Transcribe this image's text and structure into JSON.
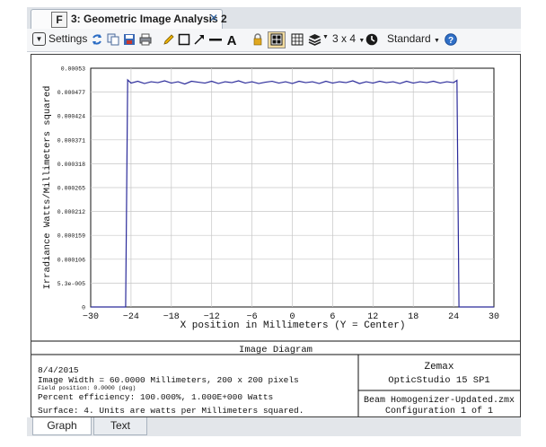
{
  "window": {
    "tab_letter": "F",
    "tab_title": "3: Geometric Image Analysis 2",
    "tab_close": "✕"
  },
  "toolbar": {
    "settings_label": "Settings",
    "layout_label": "3 x 4",
    "standard_label": "Standard",
    "icons": [
      "refresh-icon",
      "copy-icon",
      "save-icon",
      "print-icon",
      "pencil-icon",
      "rectangle-icon",
      "arrow-icon",
      "line-icon",
      "text-icon",
      "lock-icon",
      "grid-layout-icon",
      "layers-icon",
      "clock-icon",
      "help-icon"
    ],
    "accent_color": "#f3dca0"
  },
  "chart_data": {
    "type": "line",
    "ylabel": "Irradiance Watts/Millimeters squared",
    "xlabel": "X position in Millimeters (Y = Center)",
    "xlim": [
      -30,
      30
    ],
    "ylim": [
      0,
      0.00053
    ],
    "x_ticks": [
      "−30",
      "−24",
      "−18",
      "−12",
      "−6",
      "0",
      "6",
      "12",
      "18",
      "24",
      "30"
    ],
    "x_tick_values": [
      -30,
      -24,
      -18,
      -12,
      -6,
      0,
      6,
      12,
      18,
      24,
      30
    ],
    "y_ticks": [
      "0",
      "5.3e-005",
      "0.000106",
      "0.000159",
      "0.000212",
      "0.000265",
      "0.000318",
      "0.000371",
      "0.000424",
      "0.000477",
      "0.00053"
    ],
    "y_tick_values": [
      0,
      5.3e-05,
      0.000106,
      0.000159,
      0.000212,
      0.000265,
      0.000318,
      0.000371,
      0.000424,
      0.000477,
      0.00053
    ],
    "grid": true,
    "line_color": "#2b2b9a",
    "series": [
      {
        "x": [
          -30,
          -25.5,
          -24.8,
          -24.5,
          -24,
          -23,
          -22,
          -21,
          -20,
          -19,
          -18,
          -17,
          -16,
          -15,
          -14,
          -13,
          -12,
          -11,
          -10,
          -9,
          -8,
          -7,
          -6,
          -5,
          -4,
          -3,
          -2,
          -1,
          0,
          1,
          2,
          3,
          4,
          5,
          6,
          7,
          8,
          9,
          10,
          11,
          12,
          13,
          14,
          15,
          16,
          17,
          18,
          19,
          20,
          21,
          22,
          23,
          24,
          24.5,
          24.8,
          25.5,
          30
        ],
        "y": [
          0,
          0,
          0,
          0.000504,
          0.000497,
          0.000501,
          0.000496,
          0.0005,
          0.000498,
          0.000502,
          0.000497,
          0.0005,
          0.000495,
          0.000501,
          0.000499,
          0.000497,
          0.000501,
          0.000496,
          0.0005,
          0.000498,
          0.000502,
          0.000497,
          0.0005,
          0.000496,
          0.000499,
          0.000501,
          0.000497,
          0.0005,
          0.000496,
          0.000501,
          0.000498,
          0.0005,
          0.000496,
          0.000501,
          0.000497,
          0.0005,
          0.000498,
          0.000502,
          0.000496,
          0.0005,
          0.000497,
          0.000501,
          0.000498,
          0.0005,
          0.000496,
          0.000501,
          0.000497,
          0.0005,
          0.000498,
          0.000501,
          0.000497,
          0.0005,
          0.000498,
          0.000503,
          0,
          0,
          0
        ]
      }
    ]
  },
  "info": {
    "header": "Image Diagram",
    "date": "8/4/2015",
    "image_width": "Image Width = 60.0000 Millimeters, 200 x 200 pixels",
    "field_position": "Field position:    0.0000 (deg)",
    "efficiency": "Percent efficiency: 100.000%, 1.000E+000 Watts",
    "surface": "Surface: 4. Units are watts per Millimeters squared.",
    "brand": "Zemax",
    "product": "OpticStudio 15 SP1",
    "file": "Beam Homogenizer-Updated.zmx",
    "configuration": "Configuration 1 of 1"
  },
  "bottom_tabs": [
    "Graph",
    "Text"
  ]
}
